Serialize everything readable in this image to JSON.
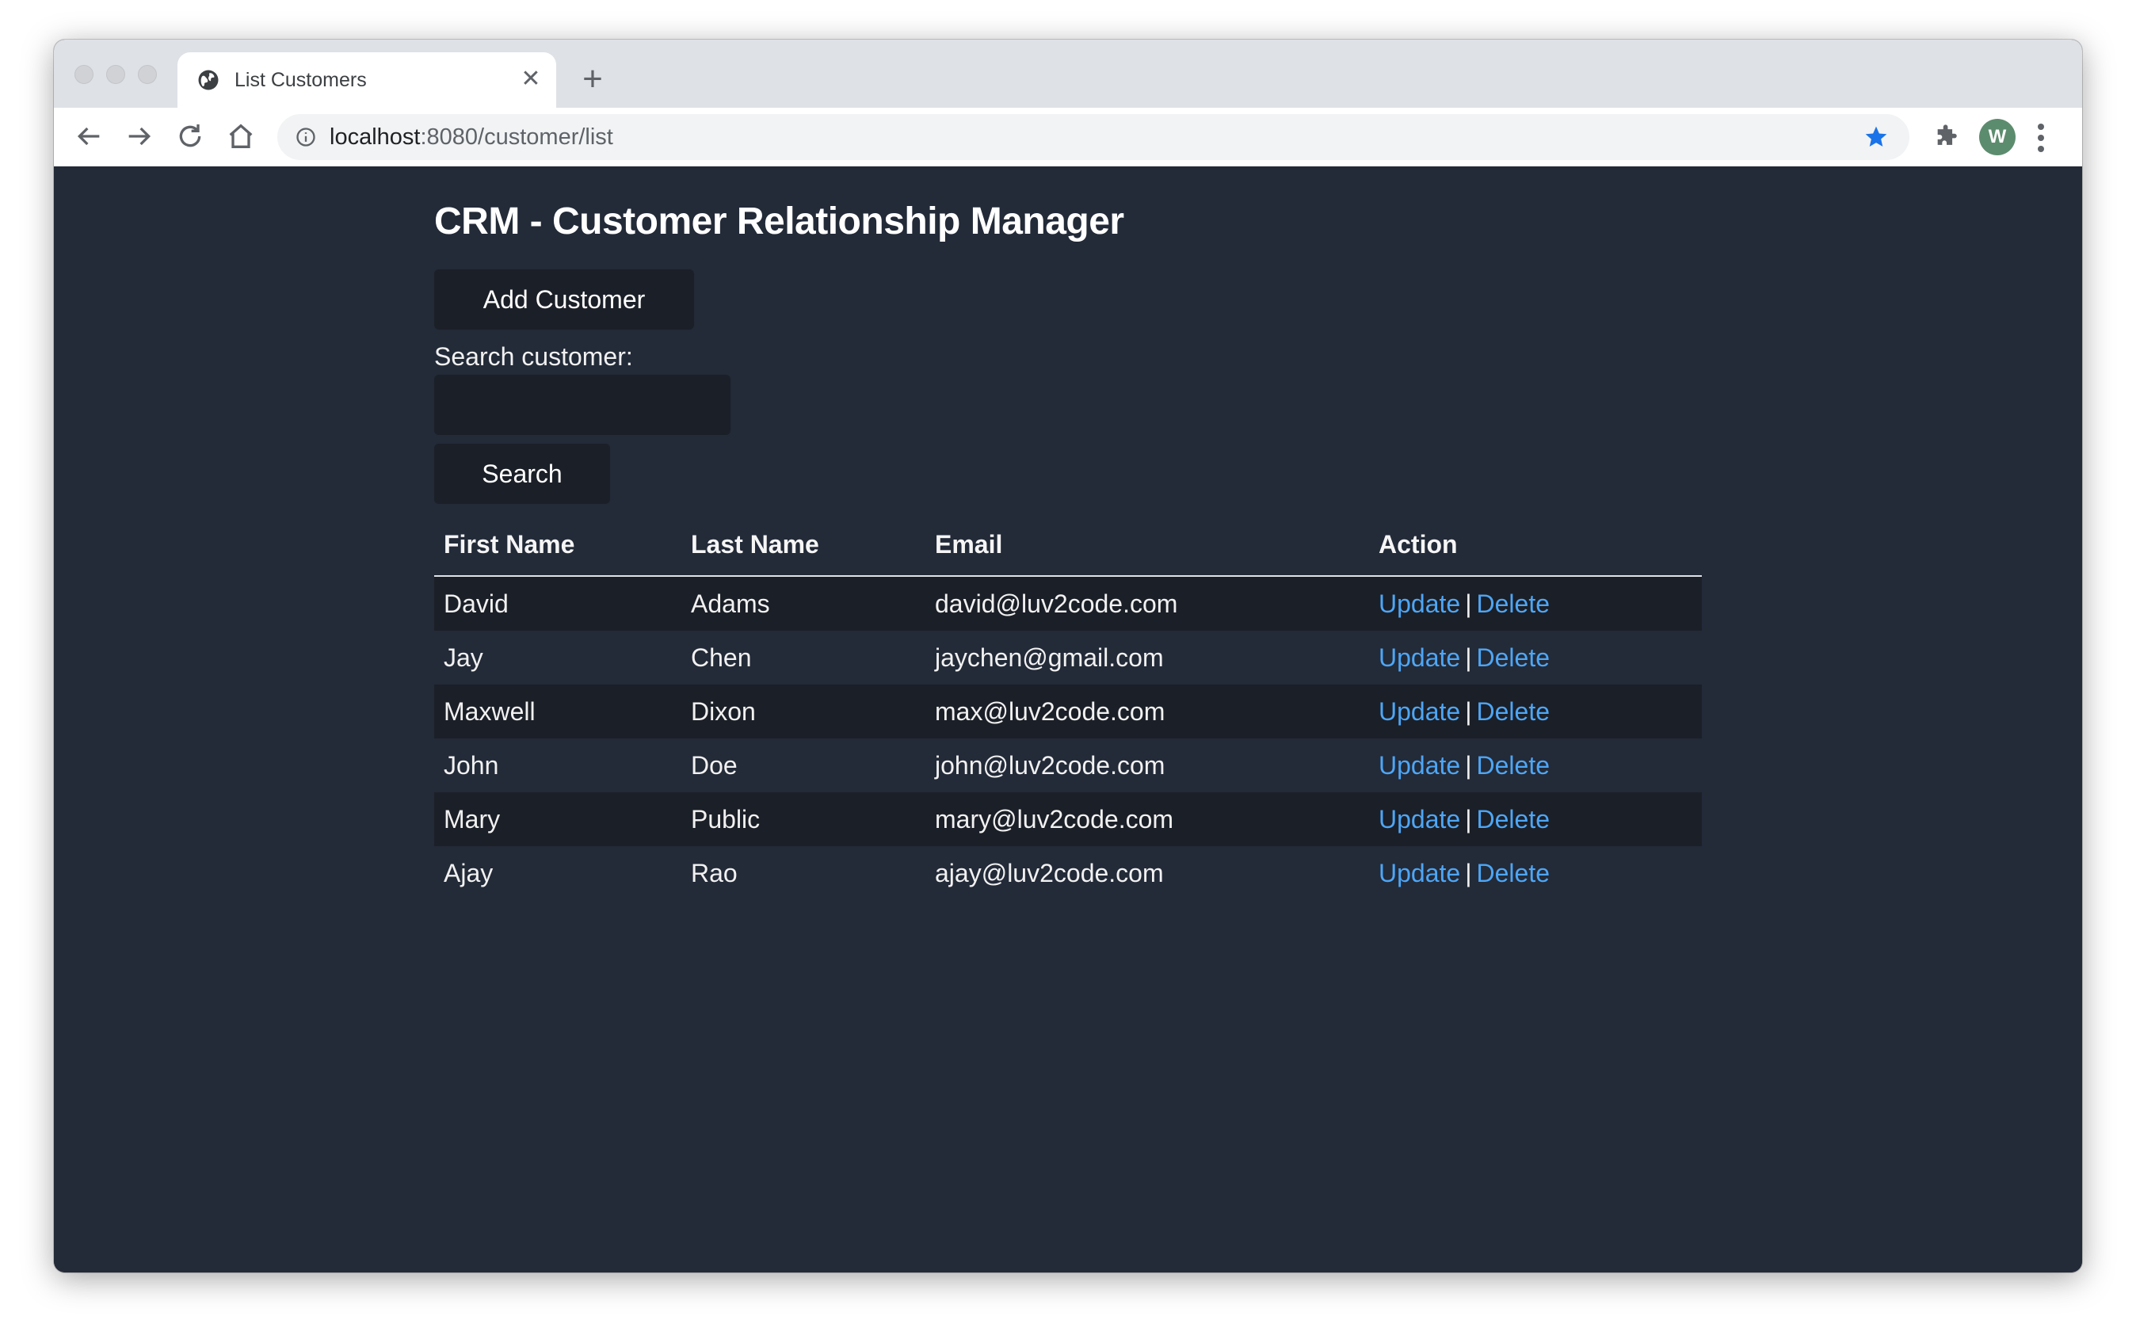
{
  "browser": {
    "tab_title": "List Customers",
    "url_host": "localhost",
    "url_path": ":8080/customer/list",
    "avatar_initials": "W"
  },
  "page": {
    "title": "CRM - Customer Relationship Manager",
    "add_button": "Add Customer",
    "search_label": "Search customer:",
    "search_value": "",
    "search_button": "Search"
  },
  "table": {
    "headers": [
      "First Name",
      "Last Name",
      "Email",
      "Action"
    ],
    "rows": [
      {
        "first": "David",
        "last": "Adams",
        "email": "david@luv2code.com"
      },
      {
        "first": "Jay",
        "last": "Chen",
        "email": "jaychen@gmail.com"
      },
      {
        "first": "Maxwell",
        "last": "Dixon",
        "email": "max@luv2code.com"
      },
      {
        "first": "John",
        "last": "Doe",
        "email": "john@luv2code.com"
      },
      {
        "first": "Mary",
        "last": "Public",
        "email": "mary@luv2code.com"
      },
      {
        "first": "Ajay",
        "last": "Rao",
        "email": "ajay@luv2code.com"
      }
    ],
    "action_update": "Update",
    "action_separator": "|",
    "action_delete": "Delete"
  },
  "colors": {
    "page_background": "#232a38",
    "button_background": "#1b1f27",
    "link": "#4ea6f5",
    "star": "#1a73e8"
  }
}
